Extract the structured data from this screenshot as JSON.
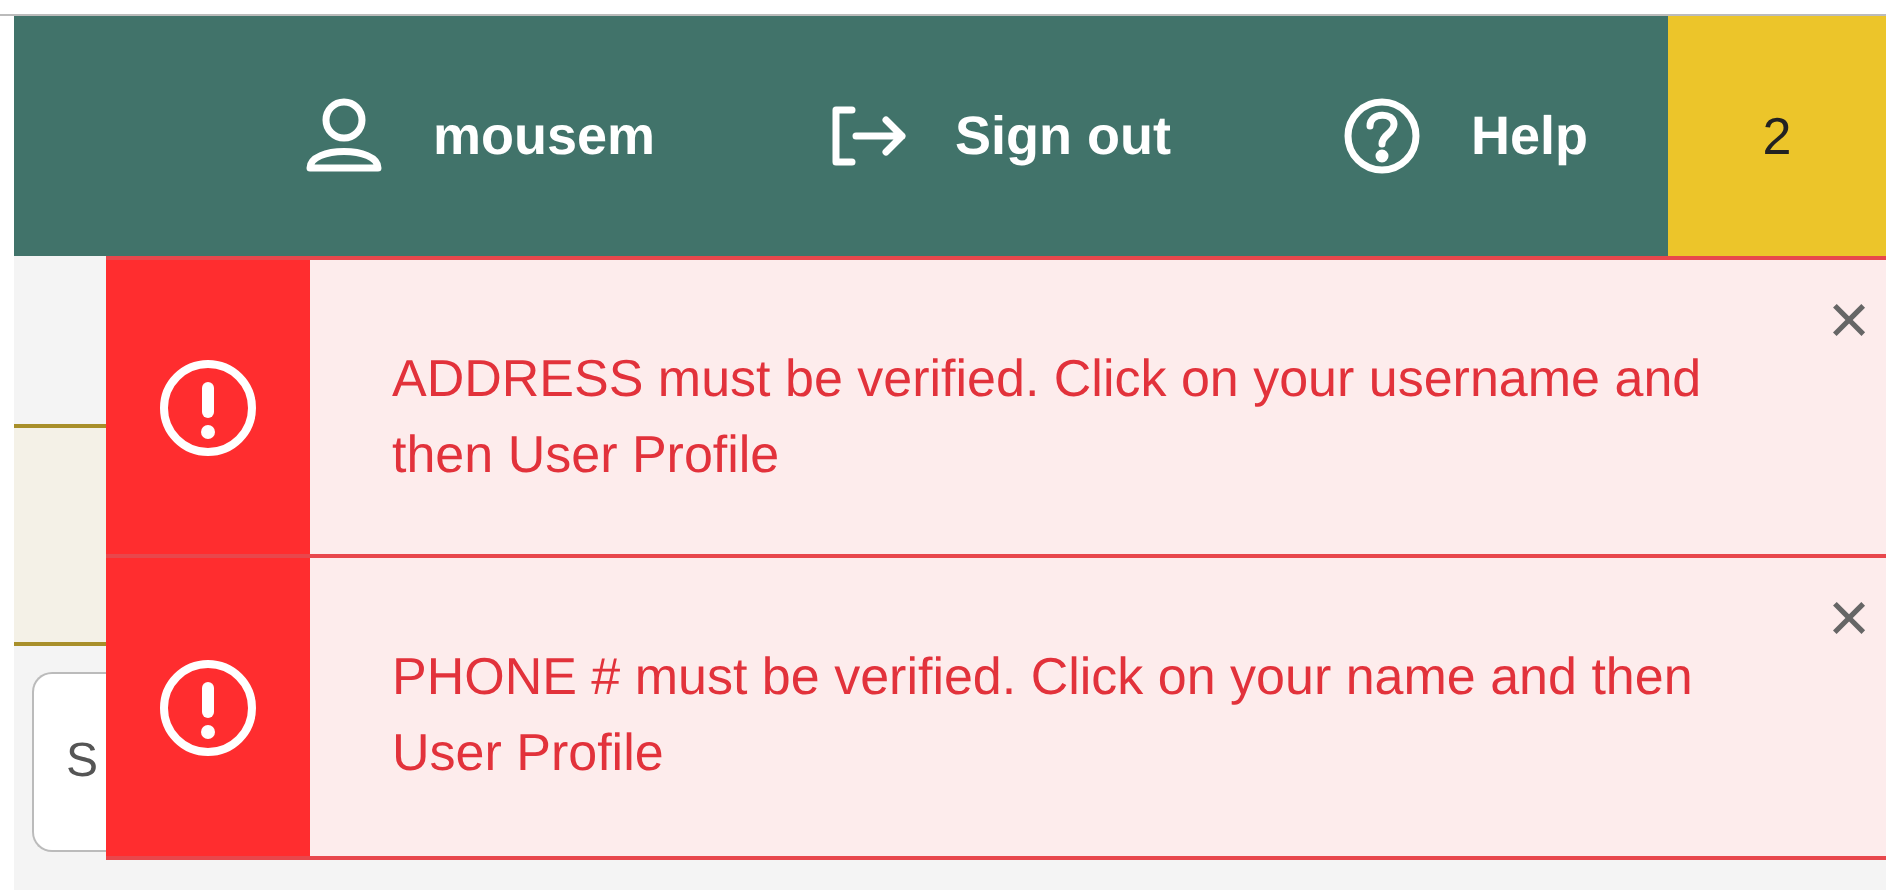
{
  "header": {
    "items": [
      {
        "kind": "user",
        "label": "mousem"
      },
      {
        "kind": "signout",
        "label": "Sign out"
      },
      {
        "kind": "help",
        "label": "Help"
      }
    ],
    "badge": "2"
  },
  "search": {
    "placeholder": "S"
  },
  "alerts": [
    {
      "message": "ADDRESS must be verified. Click on your username and then User Profile",
      "close": "×"
    },
    {
      "message": "PHONE # must be verified. Click on your name and then User Profile",
      "close": "×"
    }
  ]
}
